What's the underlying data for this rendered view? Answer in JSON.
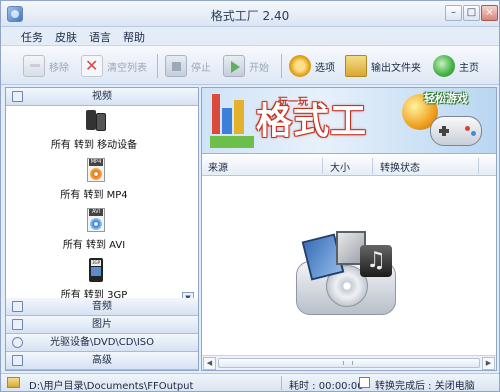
{
  "window": {
    "title": "格式工厂 2.40"
  },
  "menu": [
    "任务",
    "皮肤",
    "语言",
    "帮助"
  ],
  "toolbar": {
    "remove": "移除",
    "clear_list": "清空列表",
    "stop": "停止",
    "start": "开始",
    "options": "选项",
    "output_folder": "输出文件夹",
    "home": "主页"
  },
  "sidebar": {
    "active_category": "视频",
    "items": [
      {
        "label": "所有 转到 移动设备",
        "icon": "mobile-devices-icon"
      },
      {
        "label": "所有 转到 MP4",
        "icon": "mp4-file-icon",
        "badge": "MP4"
      },
      {
        "label": "所有 转到 AVI",
        "icon": "avi-file-icon",
        "badge": "AVI"
      },
      {
        "label": "所有 转到 3GP",
        "icon": "3gp-file-icon",
        "badge": "3GP"
      }
    ],
    "categories": [
      "音频",
      "图片",
      "光驱设备\\DVD\\CD\\ISO",
      "高级"
    ]
  },
  "banner": {
    "text_main": "格式工",
    "text_small": "玩一玩",
    "text_side": "轻松游戏"
  },
  "task_table": {
    "columns": [
      "来源",
      "大小",
      "转换状态"
    ]
  },
  "statusbar": {
    "output_path": "D:\\用户目录\\Documents\\FFOutput",
    "elapsed": "耗时 : 00:00:00",
    "after_convert": "转换完成后 : 关闭电脑"
  }
}
